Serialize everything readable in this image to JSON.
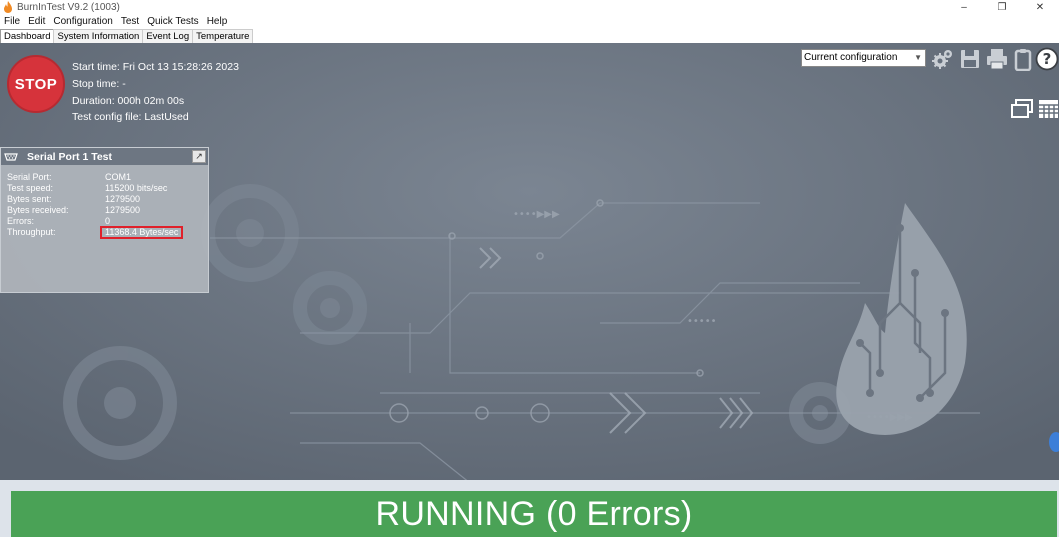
{
  "window": {
    "title": "BurnInTest V9.2 (1003)",
    "minimize_glyph": "–",
    "restore_glyph": "❐",
    "close_glyph": "✕"
  },
  "menu": [
    "File",
    "Edit",
    "Configuration",
    "Test",
    "Quick Tests",
    "Help"
  ],
  "tabs": [
    "Dashboard",
    "System Information",
    "Event Log",
    "Temperature"
  ],
  "dashboard": {
    "stop_label": "STOP",
    "start_time": "Start time: Fri Oct 13 15:28:26 2023",
    "stop_time": "Stop time: -",
    "duration": "Duration: 000h 02m 00s",
    "config_file": "Test config file: LastUsed",
    "config_select": "Current configuration",
    "toolbar_icons": [
      "gear-icon",
      "save-icon",
      "print-icon",
      "clipboard-icon",
      "help-icon"
    ],
    "view_icons": [
      "window-view-icon",
      "table-view-icon"
    ]
  },
  "serial_panel": {
    "title": "Serial Port 1 Test",
    "rows": [
      {
        "label": "Serial Port:",
        "value": "COM1"
      },
      {
        "label": "Test speed:",
        "value": "115200 bits/sec"
      },
      {
        "label": "Bytes sent:",
        "value": "1279500"
      },
      {
        "label": "Bytes received:",
        "value": "1279500"
      },
      {
        "label": "Errors:",
        "value": "0"
      },
      {
        "label": "Throughput:",
        "value": "11368.4 Bytes/sec"
      }
    ]
  },
  "status": {
    "text": "RUNNING (0 Errors)",
    "color": "#4aa256"
  },
  "colors": {
    "stop": "#d6333b",
    "background": "#66707d",
    "highlight": "#e0202a"
  }
}
